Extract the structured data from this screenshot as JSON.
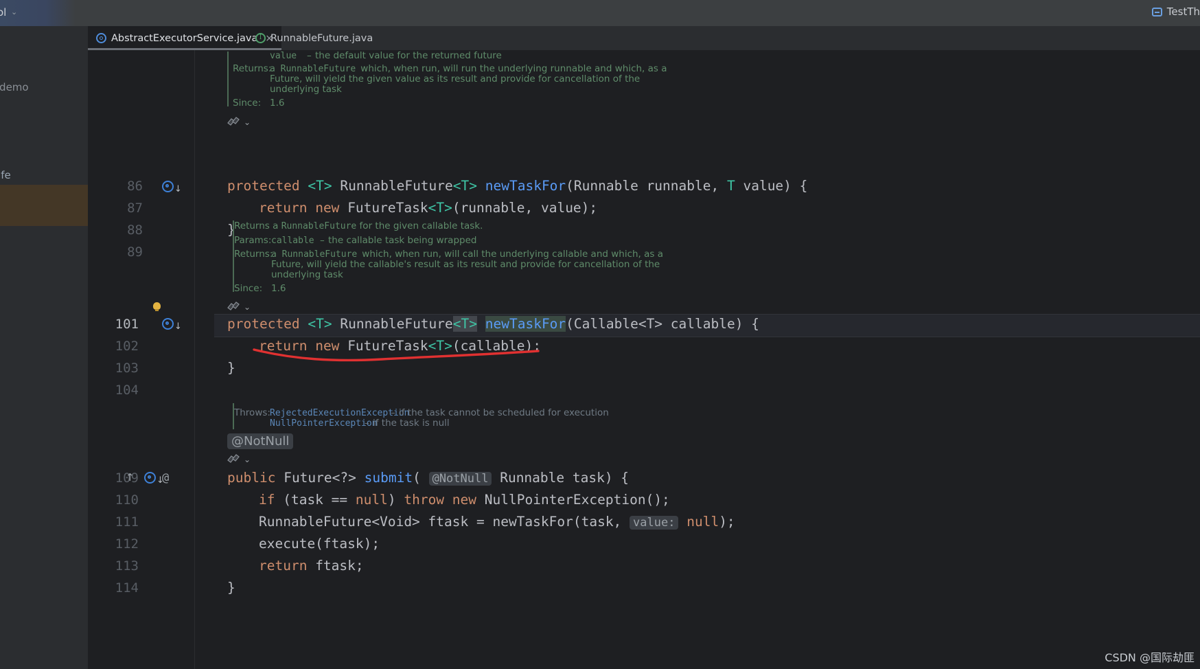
{
  "window": {
    "toolbar": {
      "project_label": "ol",
      "chevron": "⌄",
      "run_config_name": "TestTh",
      "run_icon": "run-config-icon"
    }
  },
  "left_tool_window": {
    "path_fragment": "\\demo",
    "item_fragment": "afe"
  },
  "tabs": [
    {
      "label": "AbstractExecutorService.java",
      "icon": "java-class-icon",
      "active": true,
      "close": "×"
    },
    {
      "label": "RunnableFuture.java",
      "icon": "java-interface-icon",
      "active": false,
      "close": ""
    }
  ],
  "editor": {
    "gutter_line_numbers": [
      "86",
      "87",
      "88",
      "89",
      "101",
      "102",
      "103",
      "104",
      "109",
      "110",
      "111",
      "112",
      "113",
      "114"
    ],
    "current_line": "101",
    "javadoc_1": {
      "param_name": "value",
      "param_dash": "–",
      "param_desc": "the default value for the returned future",
      "returns_label": "Returns:",
      "returns_l1_mono": "a RunnableFuture",
      "returns_l1": " which, when run, will run the underlying runnable and which, as a",
      "returns_l2": "Future, will yield the given value as its result and provide for cancellation of the",
      "returns_l3": "underlying task",
      "since_label": "Since:",
      "since_value": "1.6"
    },
    "javadoc_2": {
      "summary_a": "Returns a ",
      "summary_mono": "RunnableFuture",
      "summary_b": " for the given callable task.",
      "params_label": "Params:",
      "param_name": "callable",
      "param_dash": "–",
      "param_desc": "the callable task being wrapped",
      "returns_label": "Returns:",
      "returns_l1_mono": "a RunnableFuture",
      "returns_l1": " which, when run, will call the underlying callable and which, as a",
      "returns_l2": "Future, will yield the callable's result as its result and provide for cancellation of the",
      "returns_l3": "underlying task",
      "since_label": "Since:",
      "since_value": "1.6"
    },
    "javadoc_3": {
      "throws_label": "Throws:",
      "ex1": "RejectedExecutionException",
      "dash": "–",
      "ex1_desc": "if the task cannot be scheduled for execution",
      "ex2": "NullPointerException",
      "ex2_desc": "if the task is null"
    },
    "annotation_above": "@NotNull",
    "inlay_value_label": "value:",
    "code_lines": {
      "l86_kw": "protected",
      "l86_gen1": "<T>",
      "l86_type": "RunnableFuture",
      "l86_gen2": "<T>",
      "l86_method": "newTaskFor",
      "l86_params": "(Runnable runnable, ",
      "l86_gen3": "T",
      "l86_tail": " value) {",
      "l87_return": "return",
      "l87_new": "new",
      "l87_type": "FutureTask",
      "l87_gen": "<T>",
      "l87_args": "(runnable, value);",
      "l88": "}",
      "l101_kw": "protected",
      "l101_gen1": "<T>",
      "l101_type": "RunnableFuture",
      "l101_gen2": "<T>",
      "l101_method": "newTaskFor",
      "l101_params": "(Callable<T> callable) {",
      "l102_return": "return",
      "l102_new": "new",
      "l102_type": "FutureTask",
      "l102_gen": "<T>",
      "l102_args": "(callable);",
      "l103": "}",
      "l109_kw": "public",
      "l109_type": "Future<?>",
      "l109_method": "submit",
      "l109_open": "(",
      "l109_inlay": "@NotNull",
      "l109_rest": " Runnable task) {",
      "l110_if": "if",
      "l110_mid": " (task == ",
      "l110_null": "null",
      "l110_close": ") ",
      "l110_throw": "throw",
      "l110_new": "new",
      "l110_exc": "NullPointerException();",
      "l111": "RunnableFuture<Void> ftask = newTaskFor(task, ",
      "l111_inlay": "value:",
      "l111_null": "null",
      "l111_tail": ");",
      "l112": "execute(ftask);",
      "l113_return": "return",
      "l113_tail": " ftask;",
      "l114": "}"
    }
  },
  "annotation_overlay": {
    "type": "hand-drawn-underline",
    "color": "#e03131",
    "target_line": "102"
  },
  "watermark": "CSDN @国际劫匪",
  "colors": {
    "bg_editor": "#1e1f22",
    "bg_panel": "#2b2d30",
    "bg_toolbar": "#3c3f41",
    "keyword": "#cf8e6d",
    "generic": "#3fc6a6",
    "method": "#5a9bf6",
    "text": "#bcbec4",
    "javadoc": "#5f8c6a",
    "annotation_red": "#e03131",
    "selection_brown": "#443726"
  }
}
